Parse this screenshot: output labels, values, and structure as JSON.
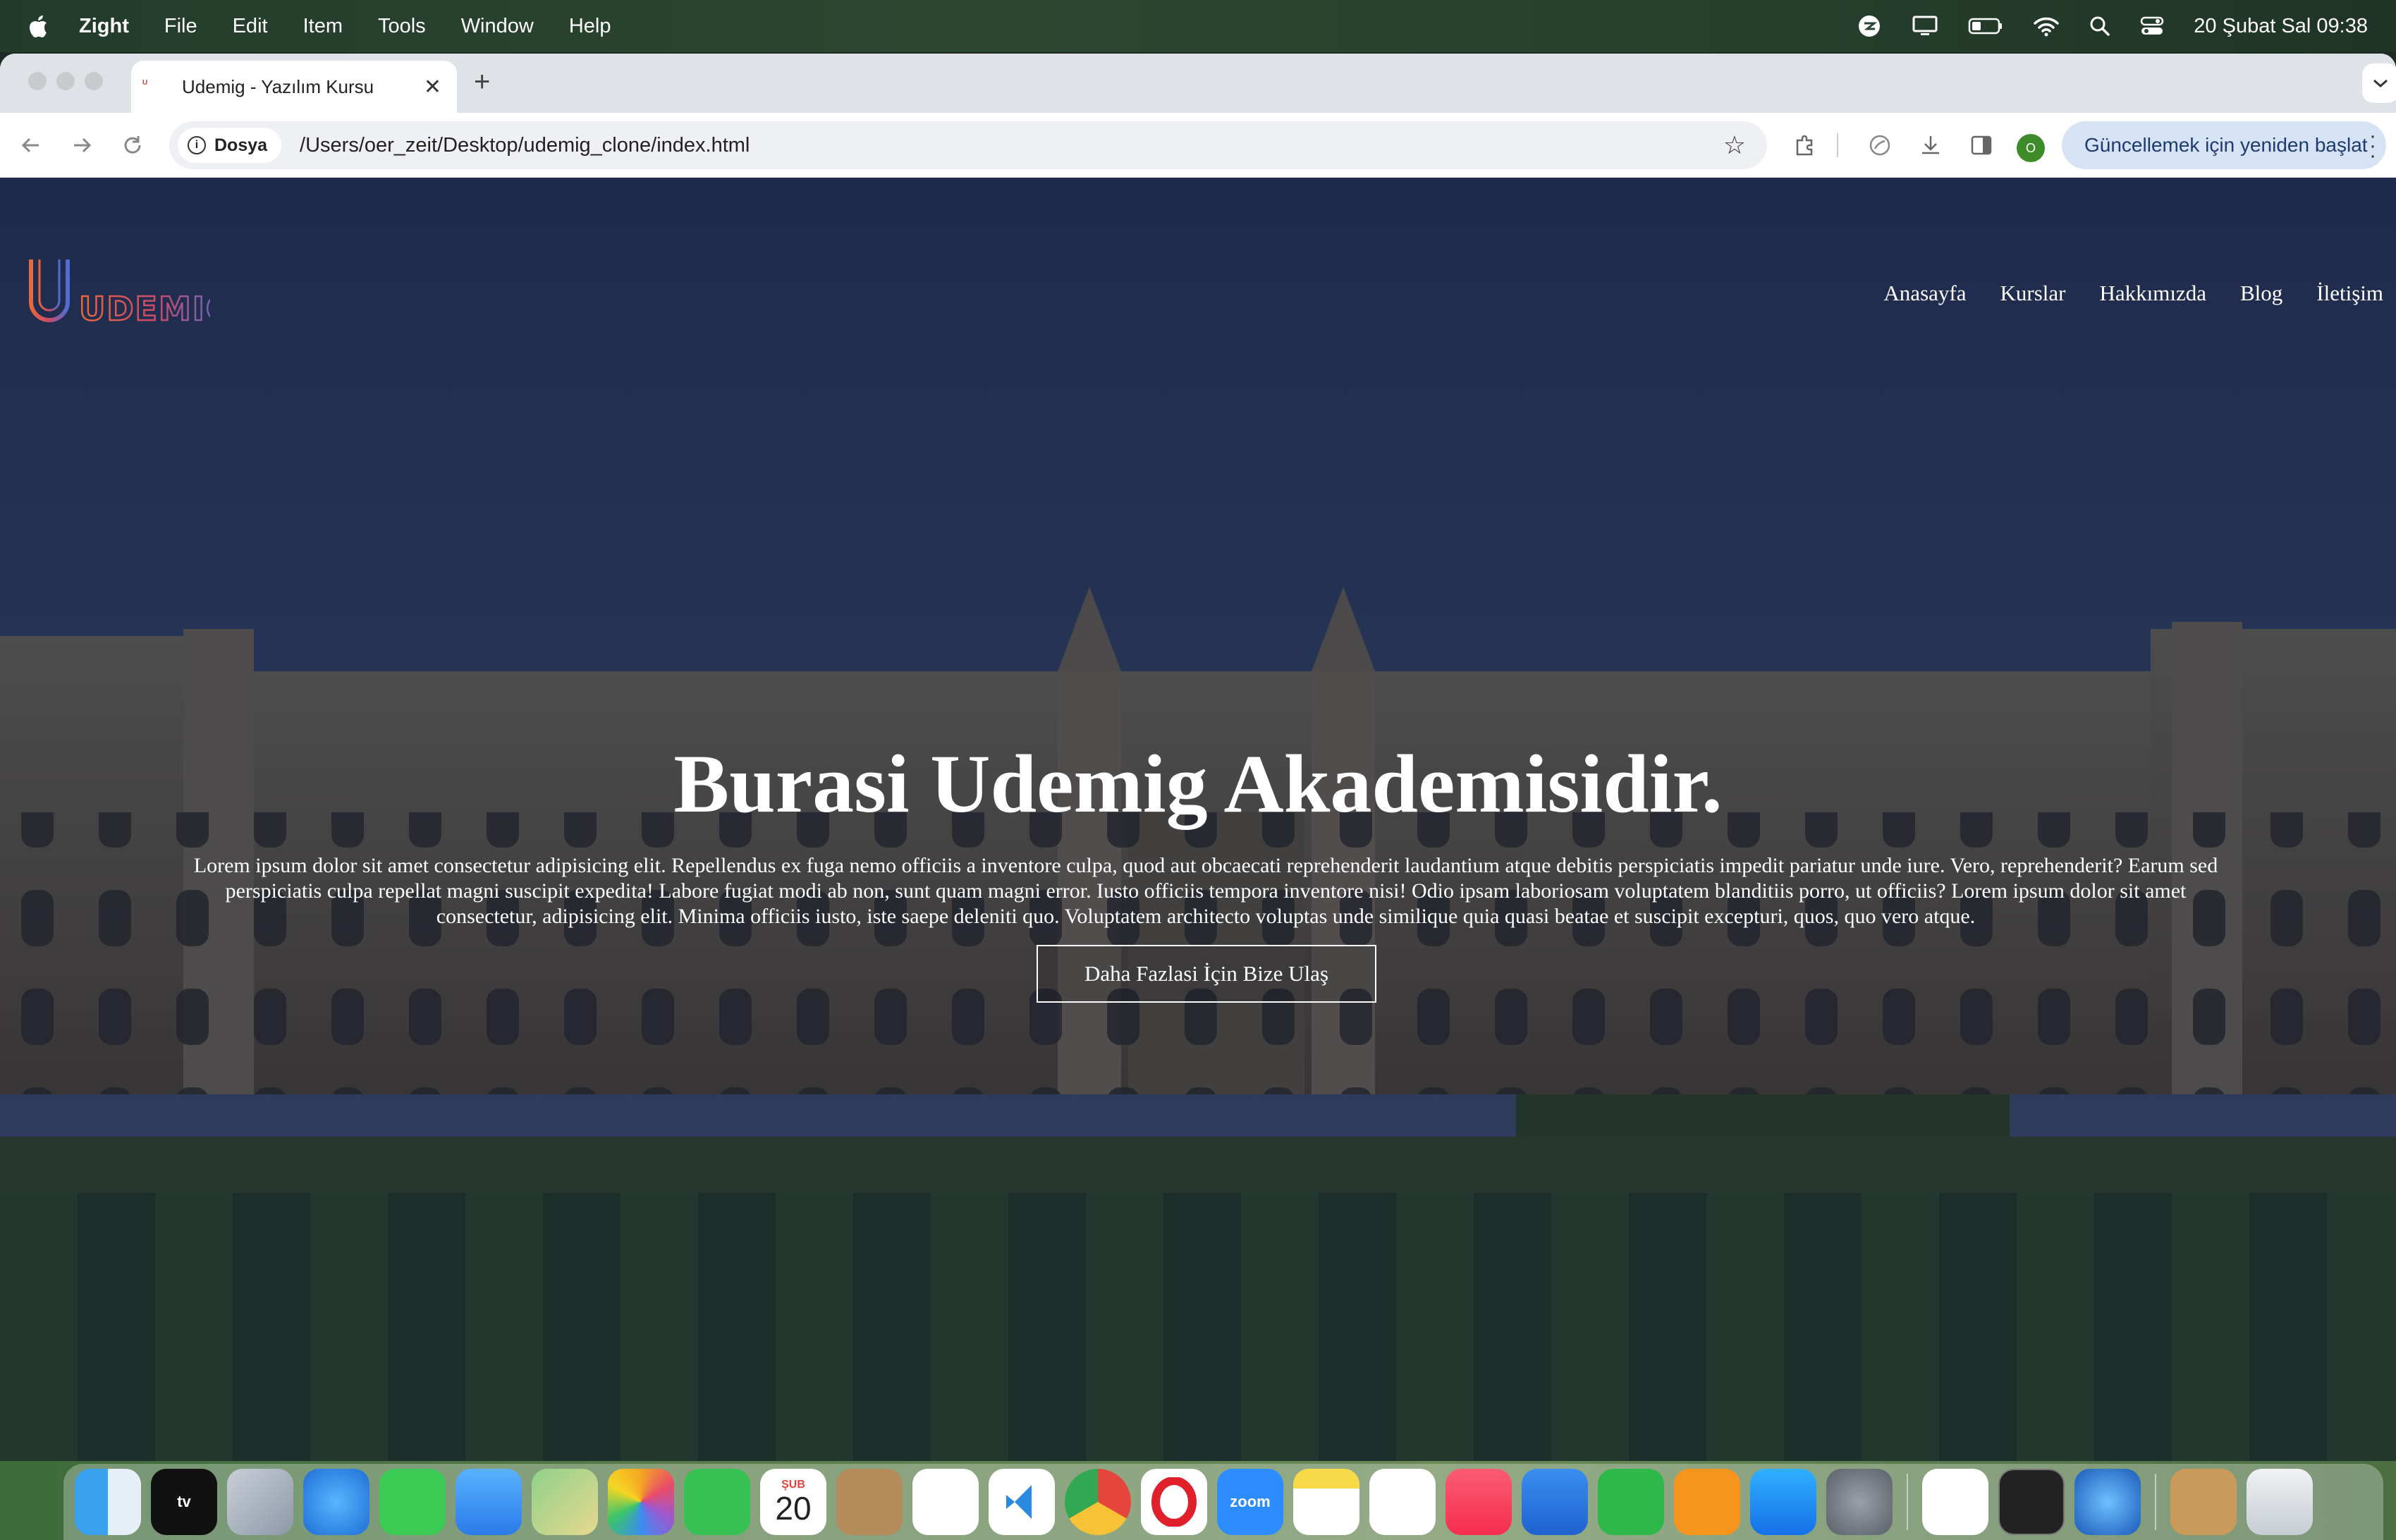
{
  "menubar": {
    "app_name": "Zight",
    "items": [
      "File",
      "Edit",
      "Item",
      "Tools",
      "Window",
      "Help"
    ],
    "clock": "20 Şubat Sal  09:38"
  },
  "browser": {
    "tab_title": "Udemig - Yazılım Kursu",
    "site_chip": "Dosya",
    "url": "/Users/oer_zeit/Desktop/udemig_clone/index.html",
    "profile_initial": "O",
    "update_label": "Güncellemek için yeniden başlat"
  },
  "site": {
    "logo_text": "UDEMIG",
    "nav": [
      "Anasayfa",
      "Kurslar",
      "Hakkımızda",
      "Blog",
      "İletişim"
    ],
    "hero_title": "Burasi Udemig Akademisidir.",
    "hero_text": "Lorem ipsum dolor sit amet consectetur adipisicing elit. Repellendus ex fuga nemo officiis a inventore culpa, quod aut obcaecati reprehenderit laudantium atque debitis perspiciatis impedit pariatur unde iure. Vero, reprehenderit? Earum sed perspiciatis culpa repellat magni suscipit expedita! Labore fugiat modi ab non, sunt quam magni error. Iusto officiis tempora inventore nisi! Odio ipsam laboriosam voluptatem blanditiis porro, ut officiis? Lorem ipsum dolor sit amet consectetur, adipisicing elit. Minima officiis iusto, iste saepe deleniti quo. Voluptatem architecto voluptas unde similique quia quasi beatae et suscipit excepturi, quos, quo vero atque.",
    "cta_label": "Daha Fazlasi İçin Bize Ulaş"
  },
  "dock": {
    "calendar_month": "ŞUB",
    "calendar_day": "20",
    "zoom_label": "zoom",
    "tv_label": "tv",
    "apps": [
      "finder-icon",
      "apple-tv-icon",
      "launchpad-icon",
      "safari-icon",
      "messages-icon",
      "mail-icon",
      "maps-icon",
      "photos-icon",
      "facetime-icon",
      "calendar-icon",
      "contacts-icon",
      "reminders-icon",
      "vscode-icon",
      "chrome-icon",
      "opera-icon",
      "zoom-icon",
      "notes-icon",
      "freeform-icon",
      "music-icon",
      "keynote-icon",
      "numbers-icon",
      "pages-icon",
      "app-store-icon",
      "system-settings-icon",
      "zight-icon",
      "terminal-icon",
      "quicktime-icon",
      "archive-icon",
      "trash-icon"
    ]
  }
}
